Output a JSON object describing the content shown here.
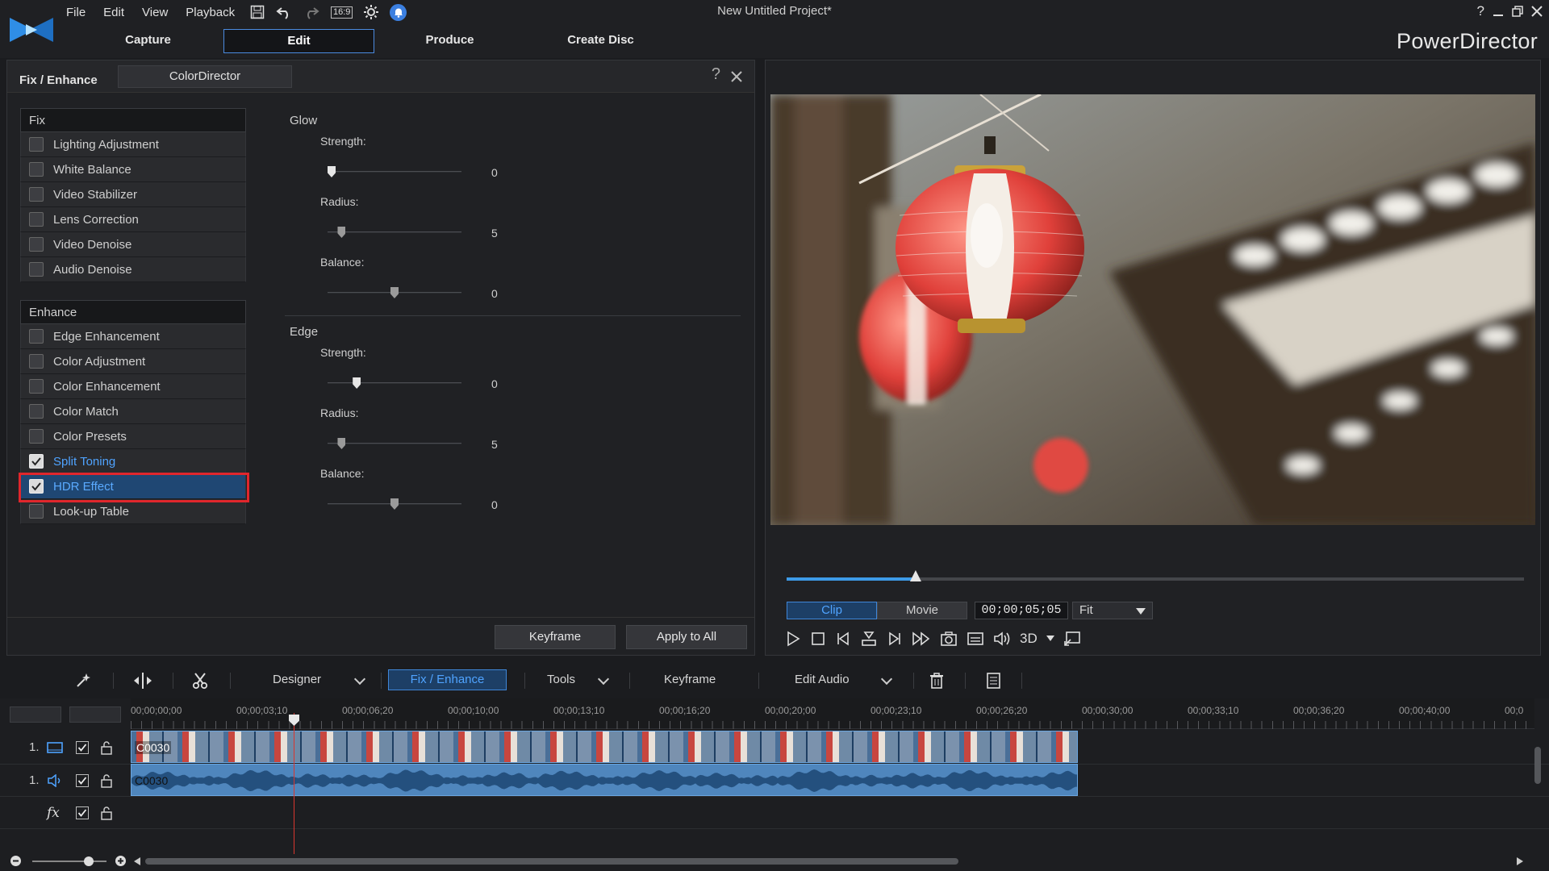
{
  "window": {
    "title": "New Untitled Project*",
    "brand": "PowerDirector",
    "menu": [
      "File",
      "Edit",
      "View",
      "Playback"
    ],
    "aspect_ratio": "16:9",
    "help_glyph": "?"
  },
  "mode_tabs": [
    "Capture",
    "Edit",
    "Produce",
    "Create Disc"
  ],
  "active_mode": "Edit",
  "fix_enhance": {
    "title": "Fix / Enhance",
    "colordirector_label": "ColorDirector",
    "help_glyph": "?",
    "fix": {
      "header": "Fix",
      "items": [
        {
          "label": "Lighting Adjustment",
          "checked": false
        },
        {
          "label": "White Balance",
          "checked": false
        },
        {
          "label": "Video Stabilizer",
          "checked": false
        },
        {
          "label": "Lens Correction",
          "checked": false
        },
        {
          "label": "Video Denoise",
          "checked": false
        },
        {
          "label": "Audio Denoise",
          "checked": false
        }
      ]
    },
    "enhance": {
      "header": "Enhance",
      "items": [
        {
          "label": "Edge Enhancement",
          "checked": false
        },
        {
          "label": "Color Adjustment",
          "checked": false
        },
        {
          "label": "Color Enhancement",
          "checked": false
        },
        {
          "label": "Color Match",
          "checked": false
        },
        {
          "label": "Color Presets",
          "checked": false
        },
        {
          "label": "Split Toning",
          "checked": true
        },
        {
          "label": "HDR Effect",
          "checked": true,
          "selected": true
        },
        {
          "label": "Look-up Table",
          "checked": false
        }
      ]
    },
    "settings": {
      "glow": {
        "title": "Glow",
        "strength": {
          "label": "Strength:",
          "value": "0",
          "fraction": 0.0
        },
        "radius": {
          "label": "Radius:",
          "value": "5",
          "fraction": 0.08
        },
        "balance": {
          "label": "Balance:",
          "value": "0",
          "fraction": 0.5
        }
      },
      "edge": {
        "title": "Edge",
        "strength": {
          "label": "Strength:",
          "value": "0",
          "fraction": 0.2
        },
        "radius": {
          "label": "Radius:",
          "value": "5",
          "fraction": 0.08
        },
        "balance": {
          "label": "Balance:",
          "value": "0",
          "fraction": 0.5
        }
      }
    },
    "buttons": {
      "keyframe": "Keyframe",
      "apply_all": "Apply to All"
    }
  },
  "preview": {
    "playback_fraction": 0.175,
    "clip_label": "Clip",
    "movie_label": "Movie",
    "timecode": "00;00;05;05",
    "fit_label": "Fit",
    "mode_3d": "3D"
  },
  "timeline_toolbar": {
    "designer": "Designer",
    "fix_enhance": "Fix / Enhance",
    "tools": "Tools",
    "keyframe": "Keyframe",
    "edit_audio": "Edit Audio"
  },
  "timeline": {
    "ruler_labels": [
      "00;00;00;00",
      "00;00;03;10",
      "00;00;06;20",
      "00;00;10;00",
      "00;00;13;10",
      "00;00;16;20",
      "00;00;20;00",
      "00;00;23;10",
      "00;00;26;20",
      "00;00;30;00",
      "00;00;33;10",
      "00;00;36;20",
      "00;00;40;00",
      "00;0"
    ],
    "tracks": [
      {
        "number": "1.",
        "type": "video",
        "clip": "C0030"
      },
      {
        "number": "1.",
        "type": "audio",
        "clip": "C0030"
      },
      {
        "number": "",
        "type": "fx",
        "label": "fx"
      }
    ]
  },
  "colors": {
    "accent": "#4fa3ff",
    "selection_bg": "#1f4773",
    "highlight_red": "#e0262c",
    "clip_blue": "#4f86bd",
    "playhead": "#d9362f"
  }
}
